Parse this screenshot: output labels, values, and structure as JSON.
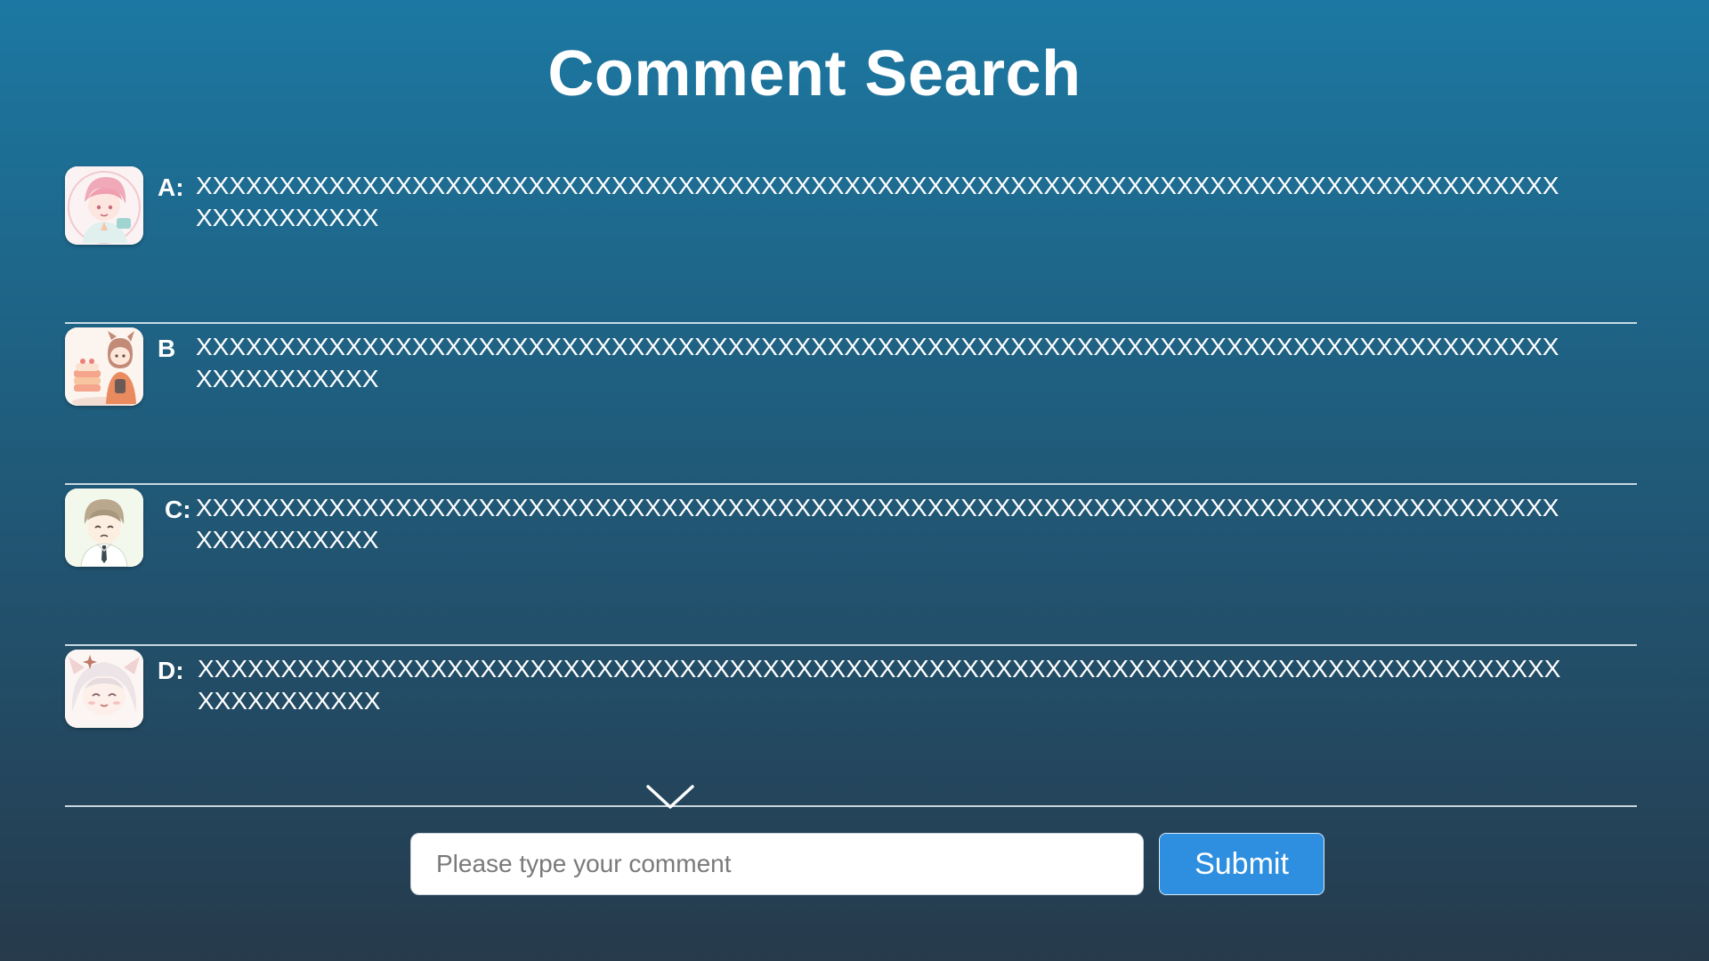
{
  "page": {
    "title": "Comment Search"
  },
  "comments": [
    {
      "label": "A:",
      "avatar_icon": "pink-hair-boy-avatar",
      "text": "XXXXXXXXXXXXXXXXXXXXXXXXXXXXXXXXXXXXXXXXXXXXXXXXXXXXXXXXXXXXXXXXXXXXXXXXXXXXXXXXXXXXXXXXXXXXX"
    },
    {
      "label": "B",
      "avatar_icon": "cake-girl-avatar",
      "text": "XXXXXXXXXXXXXXXXXXXXXXXXXXXXXXXXXXXXXXXXXXXXXXXXXXXXXXXXXXXXXXXXXXXXXXXXXXXXXXXXXXXXXXXXXXXXX"
    },
    {
      "label": "C:",
      "avatar_icon": "boy-in-shirt-avatar",
      "text": "XXXXXXXXXXXXXXXXXXXXXXXXXXXXXXXXXXXXXXXXXXXXXXXXXXXXXXXXXXXXXXXXXXXXXXXXXXXXXXXXXXXXXXXXXXXXX"
    },
    {
      "label": "D:",
      "avatar_icon": "white-hair-girl-avatar",
      "text": "XXXXXXXXXXXXXXXXXXXXXXXXXXXXXXXXXXXXXXXXXXXXXXXXXXXXXXXXXXXXXXXXXXXXXXXXXXXXXXXXXXXXXXXXXXXXX"
    }
  ],
  "controls": {
    "more_icon": "chevron-down-icon",
    "comment_placeholder": "Please type your comment",
    "comment_value": "",
    "submit_label": "Submit"
  },
  "colors": {
    "background_top": "#1c78a2",
    "background_bottom": "#263a4b",
    "submit_button": "#2e8fe0",
    "divider": "#e6f0f6"
  }
}
